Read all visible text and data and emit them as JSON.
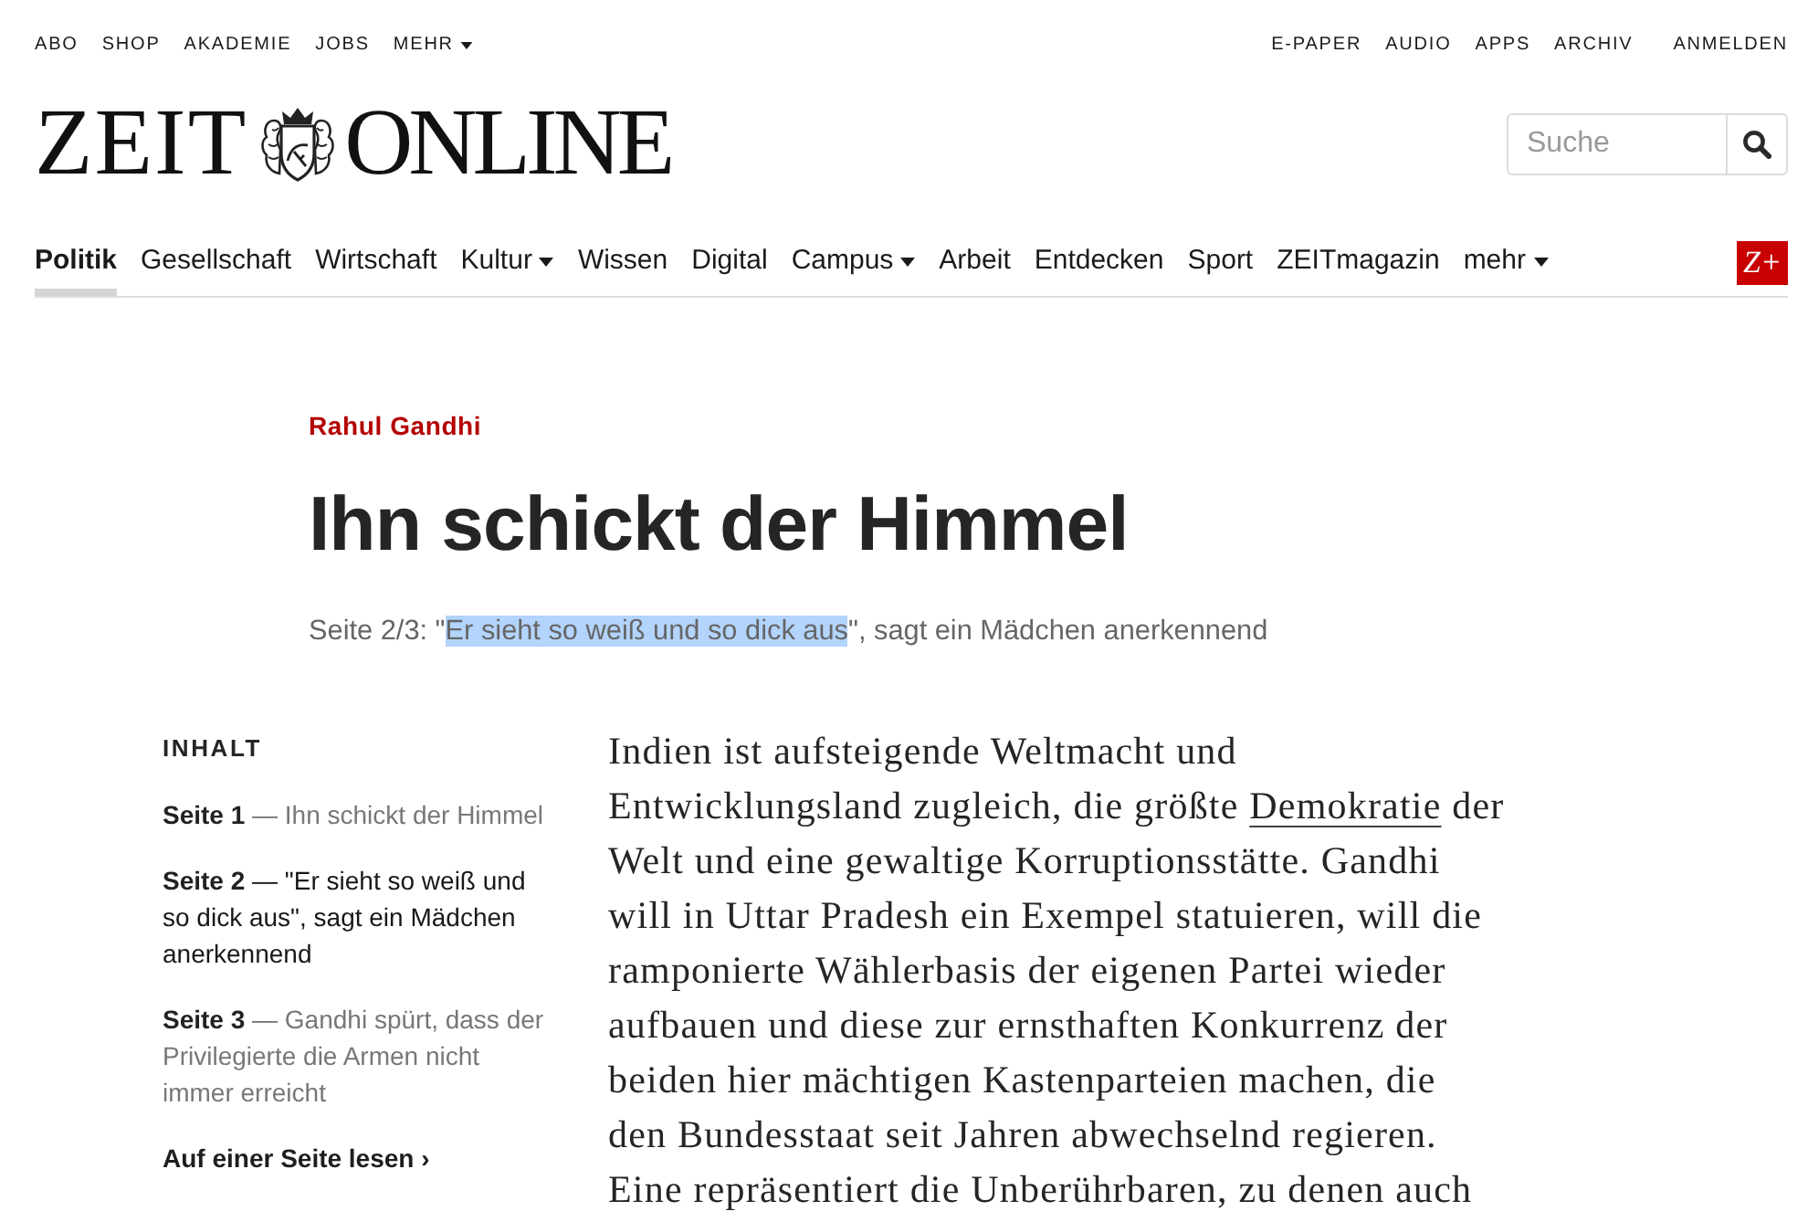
{
  "top_bar": {
    "left_links": [
      {
        "label": "ABO",
        "has_menu": false
      },
      {
        "label": "SHOP",
        "has_menu": false
      },
      {
        "label": "AKADEMIE",
        "has_menu": false
      },
      {
        "label": "JOBS",
        "has_menu": false
      },
      {
        "label": "MEHR",
        "has_menu": true
      }
    ],
    "right_links": [
      "E-PAPER",
      "AUDIO",
      "APPS",
      "ARCHIV"
    ],
    "login": "ANMELDEN"
  },
  "logo": {
    "left": "ZEIT",
    "right": "ONLINE"
  },
  "search": {
    "placeholder": "Suche"
  },
  "nav": {
    "items": [
      {
        "label": "Politik",
        "selected": true,
        "has_menu": false
      },
      {
        "label": "Gesellschaft",
        "selected": false,
        "has_menu": false
      },
      {
        "label": "Wirtschaft",
        "selected": false,
        "has_menu": false
      },
      {
        "label": "Kultur",
        "selected": false,
        "has_menu": true
      },
      {
        "label": "Wissen",
        "selected": false,
        "has_menu": false
      },
      {
        "label": "Digital",
        "selected": false,
        "has_menu": false
      },
      {
        "label": "Campus",
        "selected": false,
        "has_menu": true
      },
      {
        "label": "Arbeit",
        "selected": false,
        "has_menu": false
      },
      {
        "label": "Entdecken",
        "selected": false,
        "has_menu": false
      },
      {
        "label": "Sport",
        "selected": false,
        "has_menu": false
      },
      {
        "label": "ZEITmagazin",
        "selected": false,
        "has_menu": false
      },
      {
        "label": "mehr",
        "selected": false,
        "has_menu": true
      }
    ],
    "badge": "Z+"
  },
  "article": {
    "kicker": "Rahul Gandhi",
    "headline": "Ihn schickt der Himmel",
    "subtitle": [
      {
        "text": "Seite 2/3: \"",
        "highlighted": false
      },
      {
        "text": "Er sieht so weiß und so dick aus",
        "highlighted": true
      },
      {
        "text": "\", sagt ein Mädchen anerkennend",
        "highlighted": false
      }
    ]
  },
  "contents": {
    "heading": "INHALT",
    "pages": [
      {
        "page": "Seite 1",
        "title": "— Ihn schickt der Himmel",
        "selected": false
      },
      {
        "page": "Seite 2",
        "title": "— \"Er sieht so weiß und so dick aus\", sagt ein Mädchen anerkennend",
        "selected": true
      },
      {
        "page": "Seite 3",
        "title": "— Gandhi spürt, dass der Privilegierte die Armen nicht immer erreicht",
        "selected": false
      }
    ],
    "single_page_link": "Auf einer Seite lesen ›"
  },
  "body": {
    "paragraph": [
      {
        "kind": "text",
        "text": "Indien ist aufsteigende Weltmacht und\nEntwicklungsland zugleich, die größte "
      },
      {
        "kind": "link",
        "text": "Demokratie"
      },
      {
        "kind": "text",
        "text": " der\nWelt und eine gewaltige Korruptionsstätte. Gandhi\nwill in Uttar Pradesh ein Exempel statuieren, will die\nramponierte Wählerbasis der eigenen Partei wieder\naufbauen und diese zur ernsthaften Konkurrenz der\nbeiden hier mächtigen Kastenparteien machen, die\nden Bundesstaat seit Jahren abwechselnd regieren.\nEine repräsentiert die Unberührbaren, zu denen auch"
      }
    ]
  }
}
